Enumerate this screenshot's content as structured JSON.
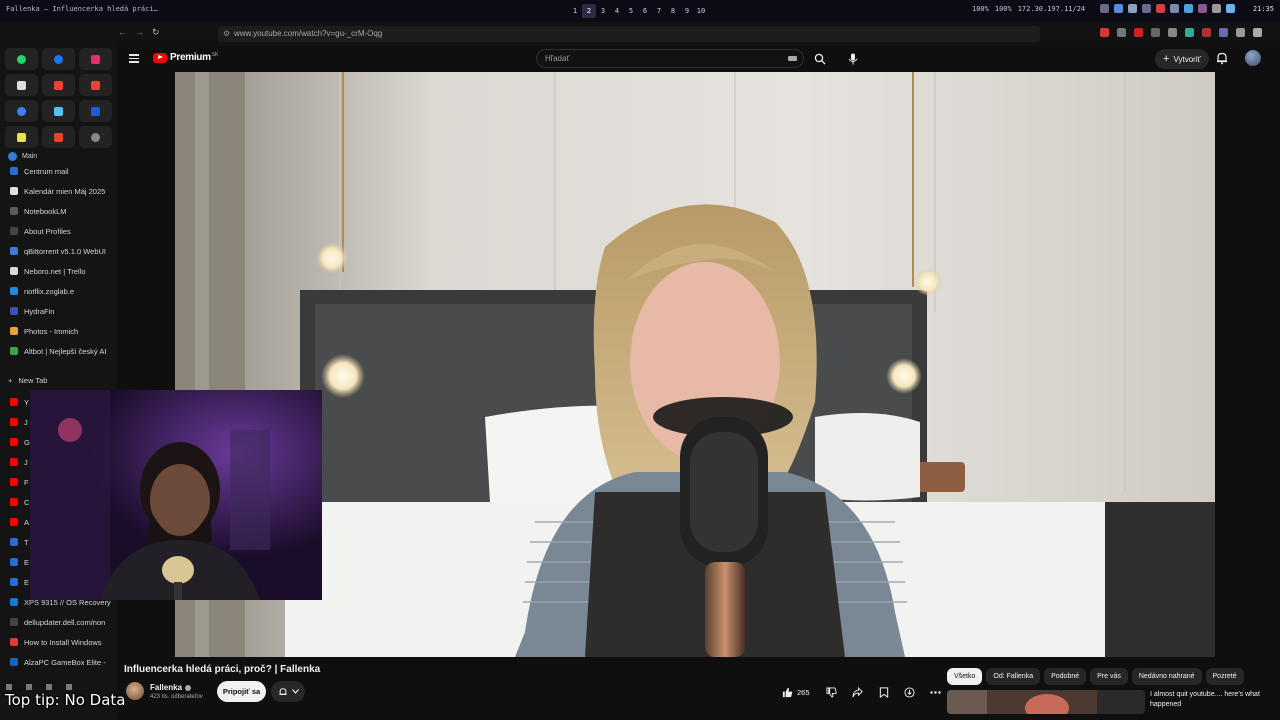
{
  "os_bar": {
    "window_title": "Fallenka – Influencerka hledá práci…",
    "workspaces": [
      "1",
      "2",
      "3",
      "4",
      "5",
      "6",
      "7",
      "8",
      "9",
      "10"
    ],
    "active_workspace": "2",
    "stats": [
      "100%",
      "100%",
      "172.30.197.11/24"
    ],
    "clock": "21:35"
  },
  "browser": {
    "url": "www.youtube.com/watch?v=gu-_crM-Oqg"
  },
  "sidebar": {
    "section_label": "Main",
    "items": [
      {
        "label": "Centrum mail",
        "color": "#2b6cd4"
      },
      {
        "label": "Kalendár mien Máj 2025",
        "color": "#e0e0e0"
      },
      {
        "label": "NotebookLM",
        "color": "#5a5a5a"
      },
      {
        "label": "About Profiles",
        "color": "#444444"
      },
      {
        "label": "qBittorrent v5.1.0 WebUI",
        "color": "#3c7bd6"
      },
      {
        "label": "Neboro.net | Trello",
        "color": "#d9d9d9"
      },
      {
        "label": "notflix.zoglab.e",
        "color": "#1e88e5"
      },
      {
        "label": "HydraFin",
        "color": "#3f51b5"
      },
      {
        "label": "Photos - Immich",
        "color": "#e8a33d"
      },
      {
        "label": "Altbot | Nejlepší český AI",
        "color": "#43a047"
      }
    ],
    "new_tab_label": "New Tab",
    "tabs": [
      {
        "label": "Y",
        "color": "#ff0000"
      },
      {
        "label": "J",
        "color": "#ff0000"
      },
      {
        "label": "G",
        "color": "#ff0000"
      },
      {
        "label": "J",
        "color": "#ff0000"
      },
      {
        "label": "F",
        "color": "#ff0000"
      },
      {
        "label": "C",
        "color": "#ff0000"
      },
      {
        "label": "A",
        "color": "#ff0000"
      },
      {
        "label": "T",
        "color": "#2b6cd4"
      },
      {
        "label": "E",
        "color": "#2b6cd4"
      },
      {
        "label": "E",
        "color": "#2b6cd4"
      }
    ],
    "bottom_items": [
      {
        "label": "XPS 9315 // OS Recovery",
        "color": "#1976d2"
      },
      {
        "label": "dellupdater.dell.com/non",
        "color": "#444444"
      },
      {
        "label": "How to Install Windows",
        "color": "#e53935"
      },
      {
        "label": "AlzaPC GameBox Elite -",
        "color": "#1565c0"
      }
    ]
  },
  "youtube": {
    "logo_text": "Premium",
    "logo_superscript": "SK",
    "search_placeholder": "Hľadať",
    "create_label": "Vytvoriť"
  },
  "video": {
    "title": "Influencerka hledá práci, proč? | Fallenka",
    "channel_name": "Fallenka",
    "subscribers": "423 tis. odberateľov",
    "join_label": "Pripojiť sa",
    "like_count": "265"
  },
  "chips": [
    "Všetko",
    "Od: Fallenka",
    "Podobné",
    "Pre vás",
    "Nedávno nahrané",
    "Pozreté"
  ],
  "active_chip": "Všetko",
  "recommendation": {
    "title": "I almost quit youtube.... here's what happened"
  },
  "overlay_tip": "Top tip: No Data"
}
